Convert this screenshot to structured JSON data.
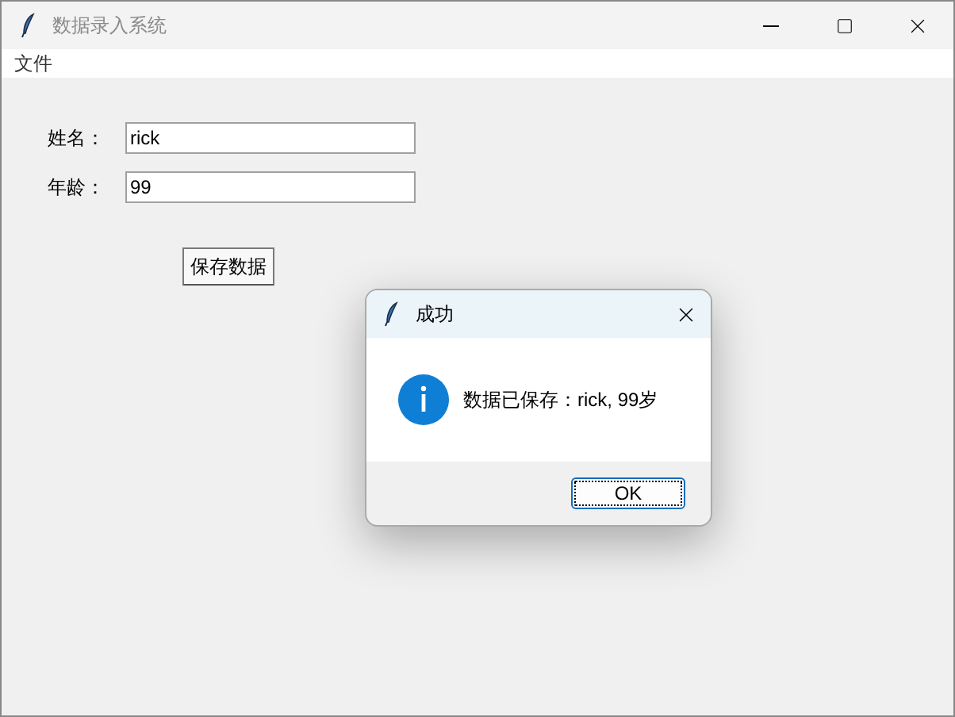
{
  "window": {
    "title": "数据录入系统"
  },
  "menu": [
    "文件"
  ],
  "fields": [
    {
      "label": "姓名：",
      "value": "rick"
    },
    {
      "label": "年龄：",
      "value": "99"
    }
  ],
  "save_button": "保存数据",
  "dialog": {
    "title": "成功",
    "message": "数据已保存：rick, 99岁",
    "button": "OK"
  }
}
